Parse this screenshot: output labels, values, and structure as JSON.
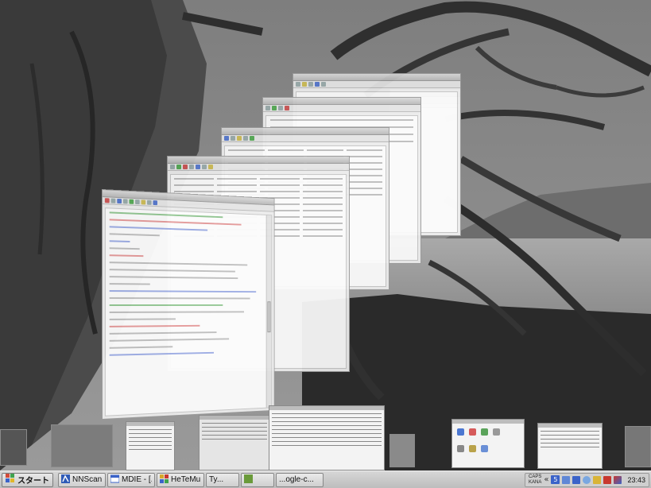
{
  "taskbar": {
    "start_label": "スタート",
    "items": [
      {
        "label": "NNScan..."
      },
      {
        "label": "MDIE - [..."
      },
      {
        "label": "HeTeMu..."
      },
      {
        "label": "Ty..."
      },
      {
        "label": ""
      },
      {
        "label": "...ogle-c..."
      }
    ],
    "tray": {
      "caps": "CAPS",
      "kana": "KANA",
      "ime_number": "5",
      "clock": "23:43"
    }
  },
  "colors": {
    "start_accent": "#2a6d2a",
    "tray_blue": "#3b63c9",
    "tray_red": "#c8382e"
  }
}
